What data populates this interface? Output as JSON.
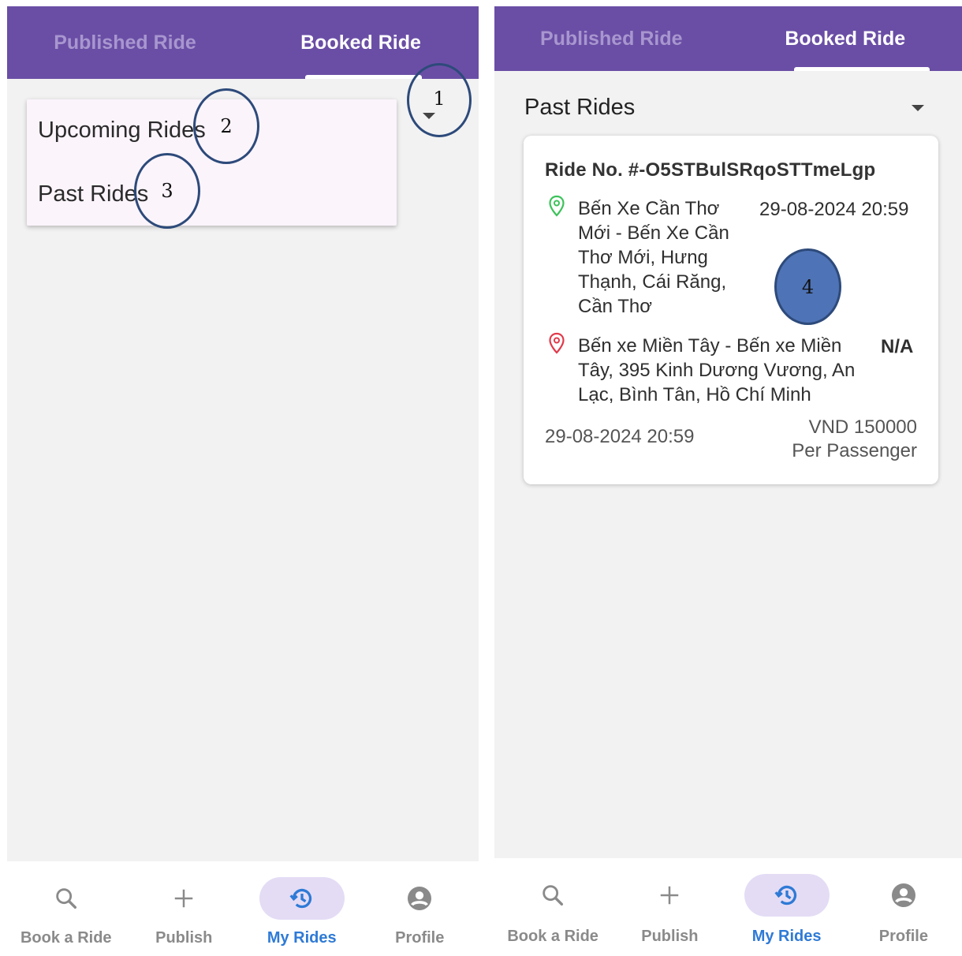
{
  "tabs": {
    "published": "Published Ride",
    "booked": "Booked Ride"
  },
  "dropdown_menu": {
    "options": [
      "Upcoming Rides",
      "Past Rides"
    ]
  },
  "filter": {
    "selected": "Past Rides"
  },
  "ride_card": {
    "ride_no": "Ride No. #-O5STBulSRqoSTTmeLgp",
    "origin": {
      "lines": [
        "Bến Xe Cần Thơ",
        "Mới - Bến Xe Cần",
        "Thơ Mới, Hưng",
        "Thạnh, Cái Răng,",
        "Cần Thơ"
      ],
      "datetime": "29-08-2024 20:59"
    },
    "destination": {
      "lines": [
        "Bến xe Miền Tây - Bến xe Miền",
        "Tây, 395 Kinh Dương Vương, An",
        "Lạc, Bình Tân, Hồ Chí Minh"
      ],
      "status": "N/A"
    },
    "date": "29-08-2024 20:59",
    "price": "VND 150000",
    "price_unit": "Per Passenger"
  },
  "bottom_nav": {
    "items": [
      {
        "label": "Book a Ride",
        "icon": "search-icon"
      },
      {
        "label": "Publish",
        "icon": "plus-icon"
      },
      {
        "label": "My Rides",
        "icon": "history-icon",
        "active": true
      },
      {
        "label": "Profile",
        "icon": "account-circle-icon"
      }
    ]
  },
  "annotations": {
    "marker_1": "1",
    "marker_2": "2",
    "marker_3": "3",
    "marker_4": "4"
  },
  "colors": {
    "header": "#6a4ea5",
    "active_nav": "#2e7ad6",
    "origin_pin": "#3cc25a",
    "destination_pin": "#e03a4a"
  }
}
